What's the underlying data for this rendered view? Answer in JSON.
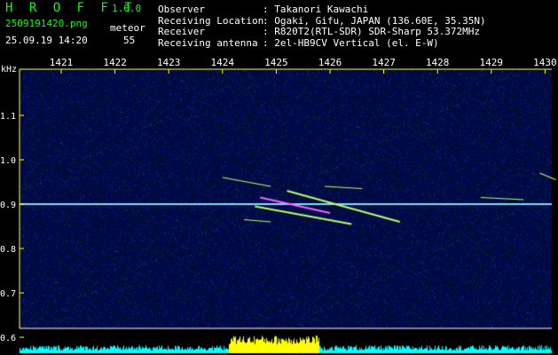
{
  "app": {
    "title": "H R O F F T",
    "version": "1.0.0"
  },
  "file": {
    "name": "2509191420.png",
    "datetime": "25.09.19 14:20"
  },
  "detection": {
    "label": "meteor",
    "count": "55"
  },
  "info": [
    {
      "label": "Observer",
      "value": ": Takanori Kawachi"
    },
    {
      "label": "Receiving Location",
      "value": ": Ogaki, Gifu, JAPAN (136.60E, 35.35N)"
    },
    {
      "label": "Receiver",
      "value": ": R820T2(RTL-SDR) SDR-Sharp 53.372MHz"
    },
    {
      "label": "Receiving antenna",
      "value": ": 2el-HB9CV Vertical (el. E-W)"
    }
  ],
  "chart_data": {
    "type": "heatmap",
    "ylabel": "kHz",
    "x_ticks": [
      "1421",
      "1422",
      "1423",
      "1424",
      "1425",
      "1426",
      "1427",
      "1428",
      "1429",
      "1430"
    ],
    "y_ticks": [
      "1.1",
      "1.0",
      "0.9",
      "0.8",
      "0.7",
      "0.6"
    ],
    "ylim": [
      0.6,
      1.18
    ],
    "carrier_khz": 0.9,
    "echoes": [
      {
        "x0": 1424.7,
        "y0": 0.915,
        "x1": 1426.0,
        "y1": 0.88
      },
      {
        "x0": 1424.6,
        "y0": 0.895,
        "x1": 1426.4,
        "y1": 0.855
      },
      {
        "x0": 1425.2,
        "y0": 0.93,
        "x1": 1427.3,
        "y1": 0.86
      },
      {
        "x0": 1424.0,
        "y0": 0.96,
        "x1": 1424.9,
        "y1": 0.94
      },
      {
        "x0": 1425.9,
        "y0": 0.94,
        "x1": 1426.6,
        "y1": 0.935
      },
      {
        "x0": 1428.8,
        "y0": 0.915,
        "x1": 1429.6,
        "y1": 0.91
      },
      {
        "x0": 1424.4,
        "y0": 0.865,
        "x1": 1424.9,
        "y1": 0.86
      },
      {
        "x0": 1429.9,
        "y0": 0.97,
        "x1": 1430.2,
        "y1": 0.955
      }
    ],
    "colors": {
      "carrier": "#5ad8ff",
      "echo": "#b7ff6a",
      "ticks": "#ffff00",
      "baseline": "#00ffff",
      "peak": "#ffff00"
    }
  }
}
